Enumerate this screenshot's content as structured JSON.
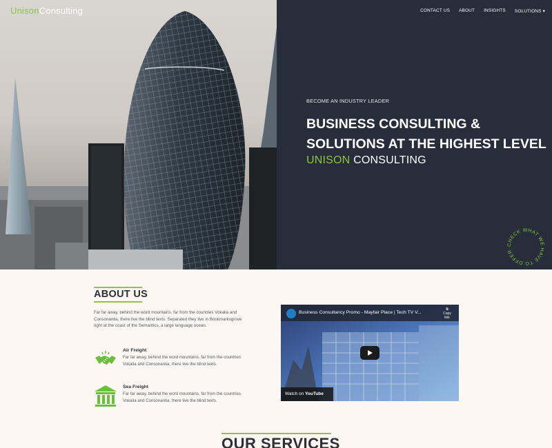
{
  "brand": {
    "part1": "Unison",
    "part2": "Consulting",
    "accent": "#8cc63f"
  },
  "nav": {
    "items": [
      "CONTACT US",
      "ABOUT",
      "INSIGHTS",
      "SOLUTIONS"
    ],
    "dropdown_icon": "caret-down-icon"
  },
  "hero": {
    "kicker": "BECOME AN INDUSTRY LEADER",
    "headline_line1": "BUSINESS CONSULTING &",
    "headline_line2": "SOLUTIONS AT THE HIGHEST LEVEL",
    "sub_green": "UNISON",
    "sub_white": "CONSULTING",
    "circle_text": "CHECK WHAT WE HAVE TO OFFER",
    "panel_color": "#282d3b"
  },
  "about": {
    "title": "ABOUT US",
    "text": "Far far away, behind the word mountains, far from the countries Vokalia and Consonantia, there live the blind texts. Separated they live in Bookmarksgrove right at the coast of the Semantics, a large language ocean.",
    "features": [
      {
        "title": "Air Freight",
        "desc": "Far far away, behind the word mountains, far from the countries Vokalia and Consonantia, there live the blind texts.",
        "icon": "handshake-icon"
      },
      {
        "title": "Sea Freight",
        "desc": "Far far away, behind the word mountains, far from the countries Vokalia and Consonantia, there live the blind texts.",
        "icon": "bank-icon"
      }
    ]
  },
  "video": {
    "title": "Business Consultancy Promo - Mayfair Place | Tech TV V...",
    "copy_label": "Copy link",
    "watch_on": "Watch on",
    "platform": "YouTube"
  },
  "services": {
    "title": "OUR SERVICES"
  }
}
